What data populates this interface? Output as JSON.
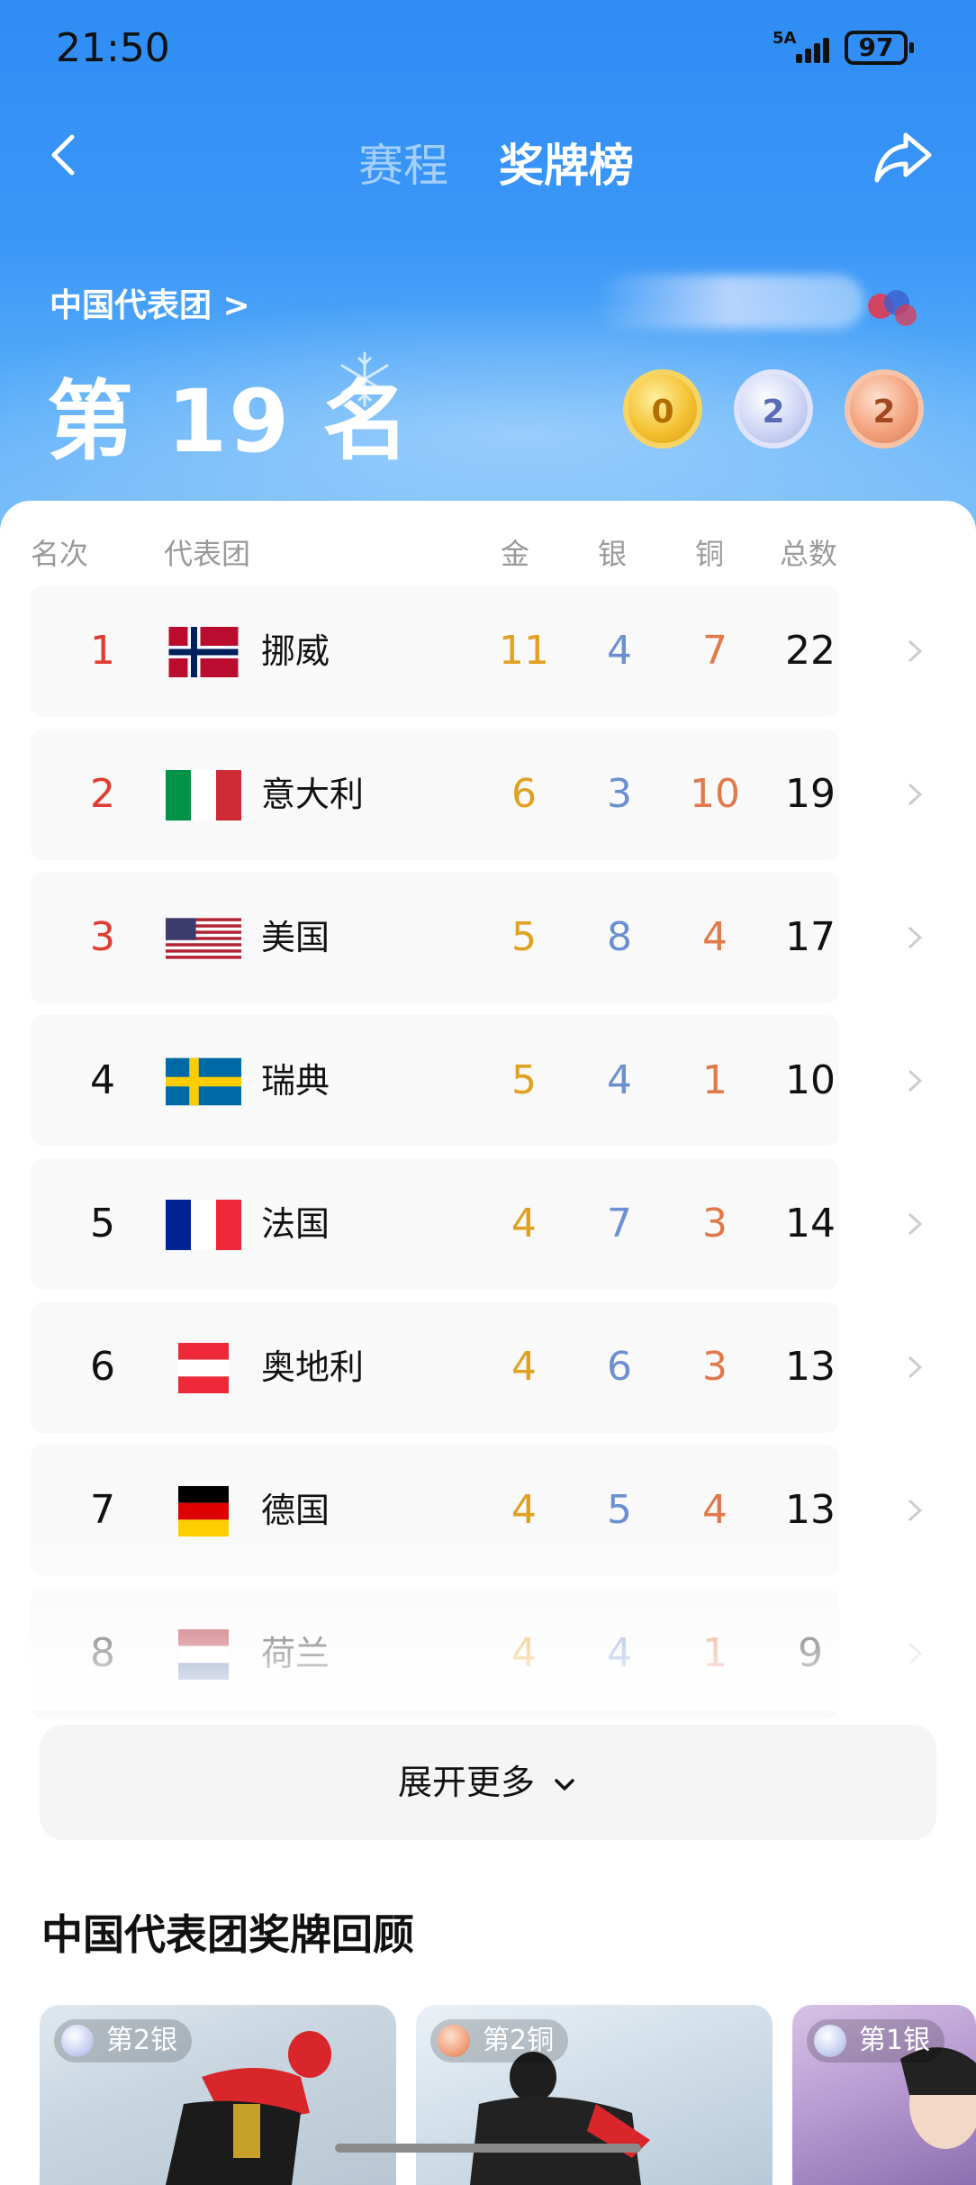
{
  "status_bar": {
    "time": "21:50",
    "signal_label": "5A",
    "battery": "97"
  },
  "nav": {
    "tab_schedule": "赛程",
    "tab_medals": "奖牌榜"
  },
  "summary": {
    "team_link": "中国代表团 >",
    "rank_text": "第 19 名",
    "gold": "0",
    "silver": "2",
    "bronze": "2"
  },
  "table": {
    "headers": {
      "rank": "名次",
      "team": "代表团",
      "gold": "金",
      "silver": "银",
      "bronze": "铜",
      "total": "总数"
    },
    "rows": [
      {
        "rank": "1",
        "name": "挪威",
        "gold": "11",
        "silver": "4",
        "bronze": "7",
        "total": "22",
        "rank_color": "#e03c31"
      },
      {
        "rank": "2",
        "name": "意大利",
        "gold": "6",
        "silver": "3",
        "bronze": "10",
        "total": "19",
        "rank_color": "#e03c31"
      },
      {
        "rank": "3",
        "name": "美国",
        "gold": "5",
        "silver": "8",
        "bronze": "4",
        "total": "17",
        "rank_color": "#e03c31"
      },
      {
        "rank": "4",
        "name": "瑞典",
        "gold": "5",
        "silver": "4",
        "bronze": "1",
        "total": "10",
        "rank_color": "#111111"
      },
      {
        "rank": "5",
        "name": "法国",
        "gold": "4",
        "silver": "7",
        "bronze": "3",
        "total": "14",
        "rank_color": "#111111"
      },
      {
        "rank": "6",
        "name": "奥地利",
        "gold": "4",
        "silver": "6",
        "bronze": "3",
        "total": "13",
        "rank_color": "#111111"
      },
      {
        "rank": "7",
        "name": "德国",
        "gold": "4",
        "silver": "5",
        "bronze": "4",
        "total": "13",
        "rank_color": "#111111"
      },
      {
        "rank": "8",
        "name": "荷兰",
        "gold": "4",
        "silver": "4",
        "bronze": "1",
        "total": "9",
        "rank_color": "#111111"
      }
    ]
  },
  "expand_label": "展开更多",
  "review": {
    "title": "中国代表团奖牌回顾",
    "cards": [
      {
        "badge": "第2银"
      },
      {
        "badge": "第2铜"
      },
      {
        "badge": "第1银"
      }
    ]
  },
  "colors": {
    "accent_blue": "#3b97f7",
    "gold": "#e0a020",
    "silver": "#6b8fcf",
    "bronze": "#e07a4a"
  }
}
